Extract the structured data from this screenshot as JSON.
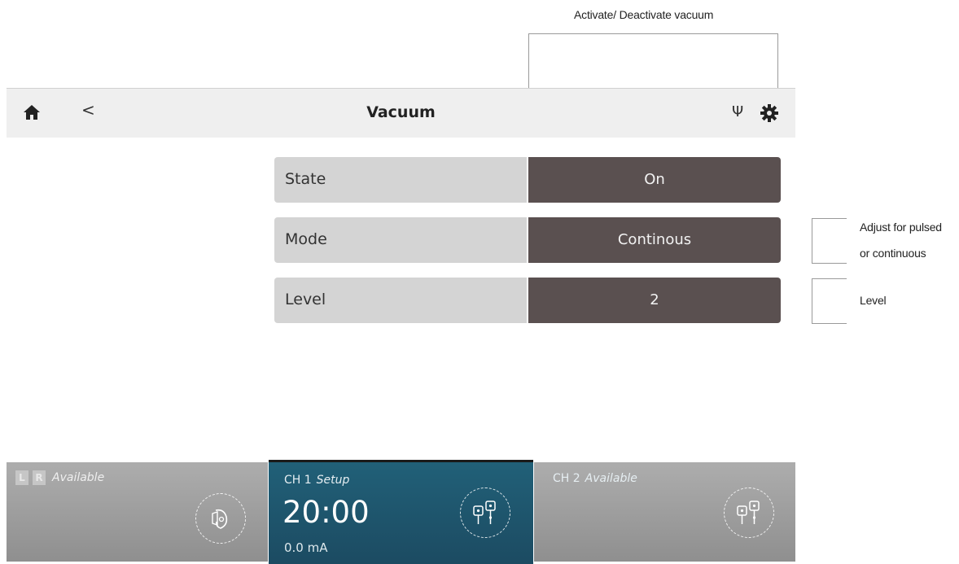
{
  "annotations": {
    "vacuum_toggle": "Activate/ Deactivate vacuum",
    "mode_line1": "Adjust for pulsed",
    "mode_line2": "or continuous",
    "level": "Level"
  },
  "header": {
    "title": "Vacuum",
    "back_icon": "<",
    "usb_icon": "Ψ"
  },
  "settings": [
    {
      "label": "State",
      "value": "On"
    },
    {
      "label": "Mode",
      "value": "Continous"
    },
    {
      "label": "Level",
      "value": "2"
    }
  ],
  "bottom": {
    "left": {
      "l": "L",
      "r": "R",
      "status": "Available"
    },
    "ch1": {
      "name": "CH 1",
      "status": "Setup",
      "time": "20:00",
      "current": "0.0 mA"
    },
    "ch2": {
      "name": "CH 2",
      "status": "Available"
    }
  },
  "colors": {
    "value_bg": "#5a5050",
    "label_bg": "#d4d4d4",
    "active_channel": "#216078"
  }
}
